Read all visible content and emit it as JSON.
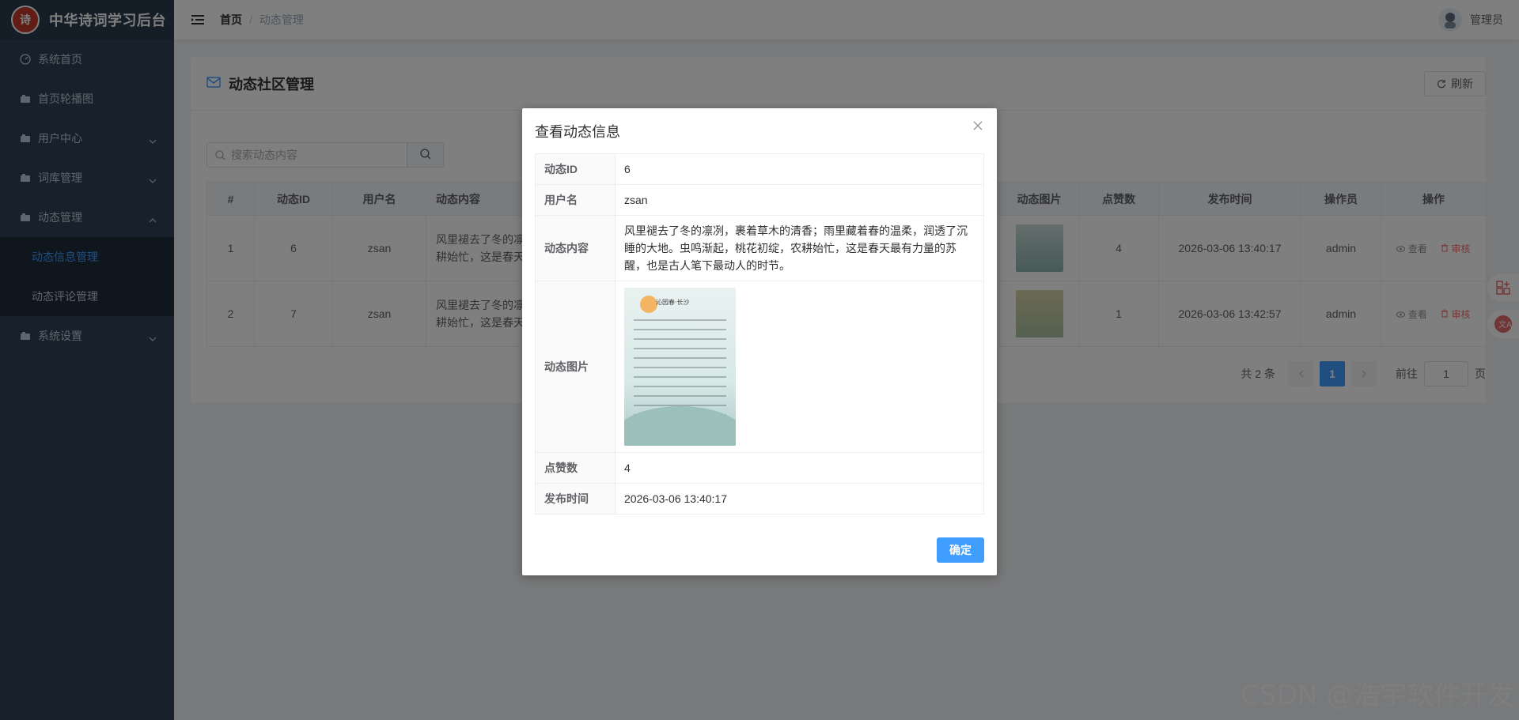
{
  "app": {
    "logo_text": "诗",
    "title": "中华诗词学习后台"
  },
  "sidebar": {
    "items": [
      {
        "label": "系统首页"
      },
      {
        "label": "首页轮播图"
      },
      {
        "label": "用户中心"
      },
      {
        "label": "词库管理"
      },
      {
        "label": "动态管理"
      },
      {
        "label": "系统设置"
      }
    ],
    "sub_items": [
      {
        "label": "动态信息管理"
      },
      {
        "label": "动态评论管理"
      }
    ]
  },
  "breadcrumb": {
    "home": "首页",
    "separator": "/",
    "current": "动态管理"
  },
  "user": {
    "name": "管理员"
  },
  "page": {
    "title": "动态社区管理",
    "refresh_label": "刷新"
  },
  "search": {
    "placeholder": "搜索动态内容"
  },
  "table": {
    "headers": [
      "#",
      "动态ID",
      "用户名",
      "动态内容",
      "动态图片",
      "点赞数",
      "发布时间",
      "操作员",
      "操作"
    ],
    "rows": [
      {
        "index": "1",
        "id": "6",
        "username": "zsan",
        "content": "风里褪去了冬的凛冽，裹着草木的清香；雨里藏着春的温柔，润透了沉睡的大地。虫鸣渐起，桃花初绽，农耕始忙，这是春天最有力量的苏醒，也是古人笔下最动人的时节。",
        "content_visible": "风里褪去了冬的凛\n耕始忙，这是春天",
        "likes": "4",
        "time": "2026-03-06 13:40:17",
        "operator": "admin",
        "view": "查看",
        "audit": "审核"
      },
      {
        "index": "2",
        "id": "7",
        "username": "zsan",
        "content_visible": "风里褪去了冬的凛\n耕始忙，这是春天",
        "likes": "1",
        "time": "2026-03-06 13:42:57",
        "operator": "admin",
        "view": "查看",
        "audit": "审核"
      }
    ]
  },
  "pagination": {
    "total": "共 2 条",
    "current": "1",
    "goto_label": "前往",
    "goto_value": "1",
    "page_unit": "页"
  },
  "modal": {
    "title": "查看动态信息",
    "fields": [
      {
        "label": "动态ID",
        "value": "6"
      },
      {
        "label": "用户名",
        "value": "zsan"
      },
      {
        "label": "动态内容",
        "value": "风里褪去了冬的凛冽，裹着草木的清香；雨里藏着春的温柔，润透了沉睡的大地。虫鸣渐起，桃花初绽，农耕始忙，这是春天最有力量的苏醒，也是古人笔下最动人的时节。"
      },
      {
        "label": "动态图片",
        "value": ""
      },
      {
        "label": "点赞数",
        "value": "4"
      },
      {
        "label": "发布时间",
        "value": "2026-03-06 13:40:17"
      }
    ],
    "image_caption": "沁园春·长沙",
    "confirm_label": "确定"
  },
  "watermark": "CSDN @浩宇软件开发",
  "colors": {
    "sidebar": "#304156",
    "primary": "#409eff",
    "danger": "#f56c6c"
  }
}
